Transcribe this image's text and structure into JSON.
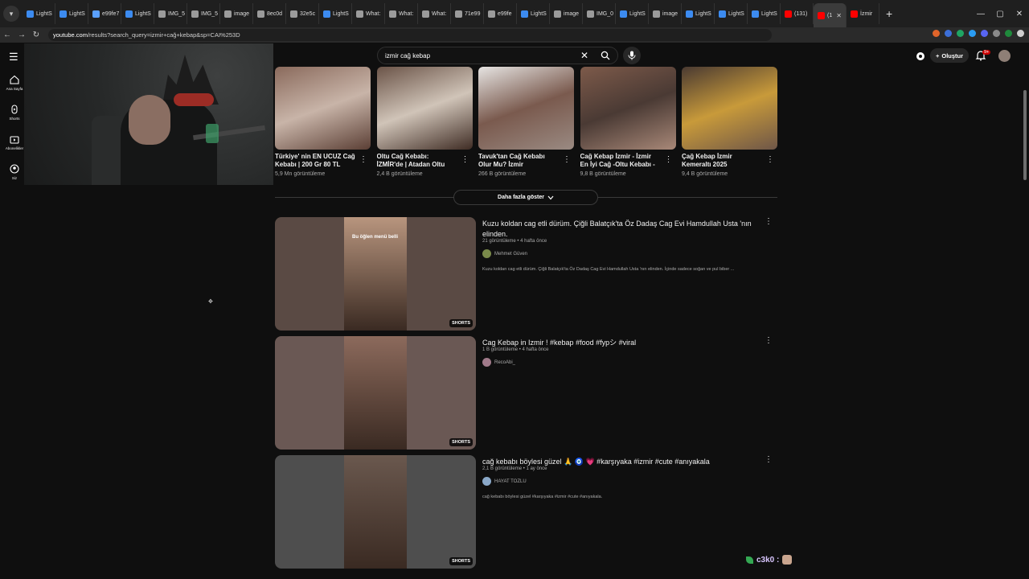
{
  "browser": {
    "tab_menu": "▾",
    "tabs": [
      {
        "label": "LightS",
        "color": "#3c8bf0"
      },
      {
        "label": "LightS",
        "color": "#3c8bf0"
      },
      {
        "label": "e99fe7",
        "color": "#5aa0ff"
      },
      {
        "label": "LightS",
        "color": "#3c8bf0"
      },
      {
        "label": "IMG_5",
        "color": "#9b9b9b"
      },
      {
        "label": "IMG_5",
        "color": "#9b9b9b"
      },
      {
        "label": "image",
        "color": "#9b9b9b"
      },
      {
        "label": "8ec0d",
        "color": "#9b9b9b"
      },
      {
        "label": "32e5c",
        "color": "#9b9b9b"
      },
      {
        "label": "LightS",
        "color": "#3c8bf0"
      },
      {
        "label": "What:",
        "color": "#9b9b9b"
      },
      {
        "label": "What:",
        "color": "#9b9b9b"
      },
      {
        "label": "What:",
        "color": "#9b9b9b"
      },
      {
        "label": "71e99",
        "color": "#9b9b9b"
      },
      {
        "label": "e99fe",
        "color": "#9b9b9b"
      },
      {
        "label": "LightS",
        "color": "#3c8bf0"
      },
      {
        "label": "image",
        "color": "#9b9b9b"
      },
      {
        "label": "IMG_0",
        "color": "#9b9b9b"
      },
      {
        "label": "LightS",
        "color": "#3c8bf0"
      },
      {
        "label": "image",
        "color": "#9b9b9b"
      },
      {
        "label": "LightS",
        "color": "#3c8bf0"
      },
      {
        "label": "LightS",
        "color": "#3c8bf0"
      },
      {
        "label": "LightS",
        "color": "#3c8bf0"
      },
      {
        "label": "(131)",
        "color": "#ff0000"
      },
      {
        "label": "(1",
        "color": "#ff0000",
        "active": true
      },
      {
        "label": "İzmir",
        "color": "#ff0000"
      }
    ],
    "new_tab": "+",
    "window_controls": [
      "—",
      "▢",
      "✕"
    ],
    "url_host": "youtube.com",
    "url_path": "/results?search_query=izmir+cağ+kebap&sp=CAI%253D"
  },
  "masthead": {
    "search_value": "izmir cağ kebap",
    "create_label": "Oluştur",
    "notification_count": "9+"
  },
  "rail": [
    {
      "label": "Ana Sayfa",
      "icon": "home-icon"
    },
    {
      "label": "Shorts",
      "icon": "shorts-icon"
    },
    {
      "label": "Abonelikler",
      "icon": "subscriptions-icon"
    },
    {
      "label": "Siz",
      "icon": "you-icon"
    }
  ],
  "shorts": [
    {
      "title": "Türkiye' nin EN UCUZ Cağ Kebabı | 200 Gr 80 TL",
      "views": "5,9 Mn görüntüleme",
      "colors": [
        "#8a6a5c",
        "#c8b4a8",
        "#5b3f35"
      ]
    },
    {
      "title": "Oltu Cağ Kebabı: İZMİR'de | Atadan Oltu Cağ Kebap",
      "views": "2,4 B görüntüleme",
      "colors": [
        "#6b5448",
        "#d0c4b8",
        "#3f2c24"
      ]
    },
    {
      "title": "Tavuk'tan Cağ Kebabı Olur Mu? İzmir Karabağlar'da ...",
      "views": "266 B görüntüleme",
      "colors": [
        "#e6e4e2",
        "#7a5a4e",
        "#9a8a82"
      ]
    },
    {
      "title": "Cağ Kebap İzmir - İzmir En İyi Cağ -Oltu Kebabı -All ...",
      "views": "9,8 B görüntüleme",
      "colors": [
        "#7d5a4a",
        "#4a3a34",
        "#a88878"
      ]
    },
    {
      "title": "Çağ Kebap İzmir Kemeraltı 2025",
      "views": "9,4 B görüntüleme",
      "colors": [
        "#4a3a32",
        "#c89a3a",
        "#6e5648"
      ]
    }
  ],
  "show_more_label": "Daha fazla göster",
  "results": [
    {
      "title": "Kuzu koldan cag etli dürüm. Çiğli Balatçık'ta Öz Dadaş Cag Evi Hamdullah Usta 'nın elinden.",
      "meta": "21 görüntüleme • 4 hafta önce",
      "channel": "Mehmet Güven",
      "channel_color": "#7a8a4a",
      "desc": "Kuzu koldan cag etli dürüm. Çiğli Balatçık'ta Öz Dadaş Cag Evi Hamdullah Usta 'nın elinden. İçinde sadece soğan ve pul biber ...",
      "overlay": "Bu öğlen menü belli",
      "badge": "SHORTS",
      "bg": "#5a4a44",
      "center": "#b8957e"
    },
    {
      "title": "Cag Kebap in Izmir ! #kebap #food #fypシ #viral",
      "meta": "1 B görüntüleme • 4 hafta önce",
      "channel": "RecoAbi_",
      "channel_color": "#a07a8a",
      "desc": "",
      "overlay": "",
      "badge": "SHORTS",
      "bg": "#6a5854",
      "center": "#8c6a5c"
    },
    {
      "title": "cağ kebabı böylesi güzel 🙏 🧿 💗 #karşıyaka #izmir #cute #anıyakala",
      "meta": "2,1 B görüntüleme • 1 ay önce",
      "channel": "HAYAT TOZLU",
      "channel_color": "#8aa8c8",
      "desc": "cağ kebabı böylesi güzel #karşıyaka #izmir #cute #anıyakala.",
      "overlay": "",
      "badge": "SHORTS",
      "bg": "#4e4e4e",
      "center": "#6a584e"
    }
  ],
  "chat": {
    "user": "c3k0 :"
  }
}
